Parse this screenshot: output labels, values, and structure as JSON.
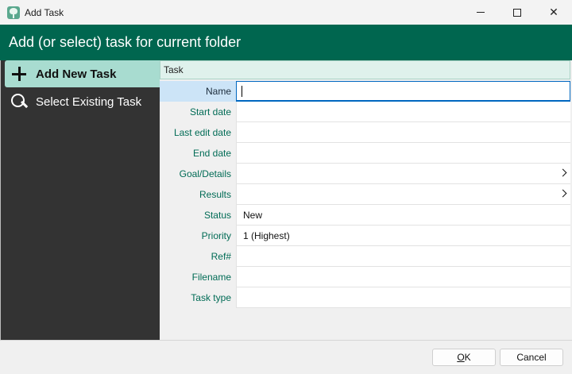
{
  "window": {
    "title": "Add Task",
    "app_icon": "tree-icon",
    "controls": [
      "minimize-icon",
      "maximize-icon",
      "close-icon"
    ],
    "close_glyph": "✕"
  },
  "header": {
    "title": "Add (or select) task for current folder",
    "background_color": "#00664f"
  },
  "sidebar": {
    "items": [
      {
        "label": "Add New Task",
        "icon": "plus-icon",
        "active": true
      },
      {
        "label": "Select Existing Task",
        "icon": "search-icon",
        "active": false
      }
    ]
  },
  "form": {
    "group_label": "Task",
    "fields": [
      {
        "label": "Name",
        "value": "",
        "selected": true
      },
      {
        "label": "Start date",
        "value": ""
      },
      {
        "label": "Last edit date",
        "value": ""
      },
      {
        "label": "End date",
        "value": ""
      },
      {
        "label": "Goal/Details",
        "value": "",
        "has_chevron": true
      },
      {
        "label": "Results",
        "value": "",
        "has_chevron": true
      },
      {
        "label": "Status",
        "value": "New"
      },
      {
        "label": "Priority",
        "value": "1 (Highest)"
      },
      {
        "label": "Ref#",
        "value": ""
      },
      {
        "label": "Filename",
        "value": ""
      },
      {
        "label": "Task type",
        "value": ""
      }
    ]
  },
  "footer": {
    "ok": {
      "accel": "O",
      "rest": "K"
    },
    "cancel_label": "Cancel"
  }
}
